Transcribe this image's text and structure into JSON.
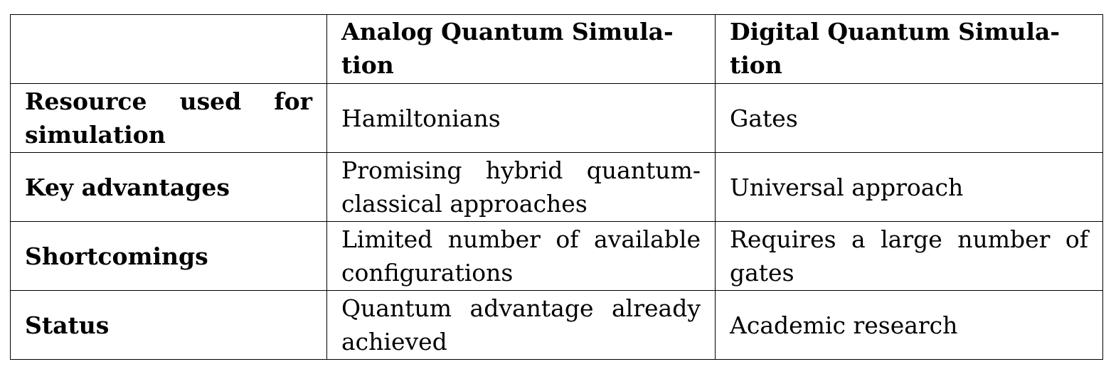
{
  "table": {
    "headers": [
      "",
      "Analog Quantum Simula-\ntion",
      "Digital Quantum Simula-\ntion"
    ],
    "rows": [
      {
        "label": "Resource used for simulation",
        "analog": "Hamiltonians",
        "digital": "Gates"
      },
      {
        "label": "Key advantages",
        "analog": "Promising hybrid quantum-classical approaches",
        "digital": "Universal approach"
      },
      {
        "label": "Shortcomings",
        "analog": "Limited number of available configurations",
        "digital": "Requires a large number of gates"
      },
      {
        "label": "Status",
        "analog": "Quantum advantage already achieved",
        "digital": "Academic research"
      }
    ]
  }
}
